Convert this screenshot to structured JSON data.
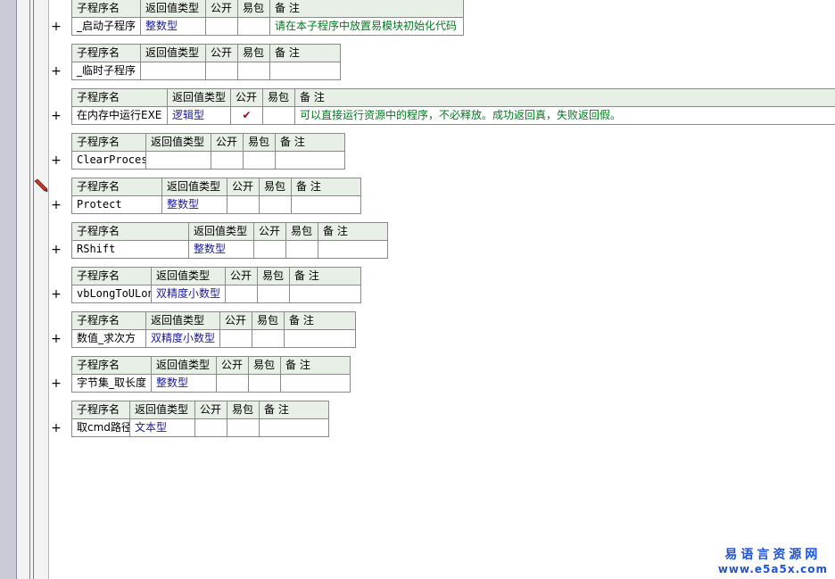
{
  "headers": {
    "name": "子程序名",
    "ret": "返回值类型",
    "public": "公开",
    "easy": "易包",
    "remark": "备 注"
  },
  "expand_glyph": "+",
  "subs": [
    {
      "name": "_启动子程序",
      "type": "整数型",
      "public": "",
      "remark": "请在本子程序中放置易模块初始化代码"
    },
    {
      "name": "_临时子程序",
      "type": "",
      "public": "",
      "remark": ""
    },
    {
      "name": "在内存中运行EXE",
      "type": "逻辑型",
      "public": "✔",
      "remark": "可以直接运行资源中的程序，不必释放。成功返回真，失败返回假。"
    },
    {
      "name": "ClearProcess",
      "type": "",
      "public": "",
      "remark": ""
    },
    {
      "name": "Protect",
      "type": "整数型",
      "public": "",
      "remark": ""
    },
    {
      "name": "RShift",
      "type": "整数型",
      "public": "",
      "remark": ""
    },
    {
      "name": "vbLongToULong",
      "type": "双精度小数型",
      "public": "",
      "remark": ""
    },
    {
      "name": "数值_求次方",
      "type": "双精度小数型",
      "public": "",
      "remark": ""
    },
    {
      "name": "字节集_取长度",
      "type": "整数型",
      "public": "",
      "remark": ""
    },
    {
      "name": "取cmd路径",
      "type": "文本型",
      "public": "",
      "remark": ""
    }
  ],
  "watermark": {
    "title": "易语言资源网",
    "url": "www.e5a5x.com"
  },
  "colors": {
    "header_bg": "#e8efe6",
    "type_text": "#1a1a9a",
    "remark_text": "#007a1e",
    "check": "#b00020",
    "watermark": "#1f54d8"
  }
}
